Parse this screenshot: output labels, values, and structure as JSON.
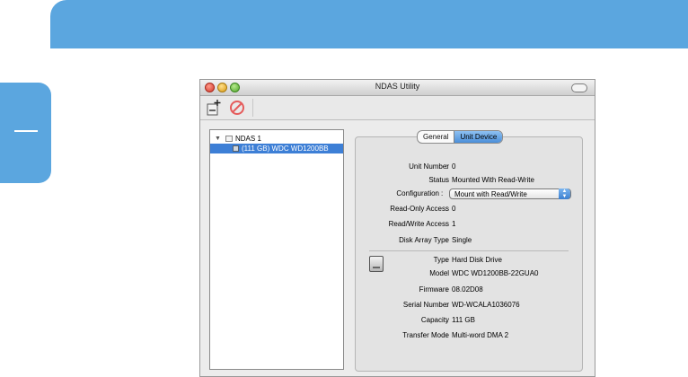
{
  "window": {
    "title": "NDAS Utility"
  },
  "toolbar": {
    "add_icon": "add-device-icon",
    "remove_icon": "remove-device-icon"
  },
  "tree": {
    "parent": {
      "label": "NDAS 1"
    },
    "child": {
      "label": "(111 GB) WDC WD1200BB"
    }
  },
  "tabs": {
    "general": "General",
    "unit_device": "Unit Device"
  },
  "details": {
    "unit_number": {
      "label": "Unit Number",
      "value": "0"
    },
    "status": {
      "label": "Status",
      "value": "Mounted With Read-Write"
    },
    "configuration": {
      "label": "Configuration",
      "value": "Mount with Read/Write"
    },
    "ro_access": {
      "label": "Read-Only Access",
      "value": "0"
    },
    "rw_access": {
      "label": "Read/Write Access",
      "value": "1"
    },
    "array_type": {
      "label": "Disk Array Type",
      "value": "Single"
    },
    "type": {
      "label": "Type",
      "value": "Hard Disk Drive"
    },
    "model": {
      "label": "Model",
      "value": "WDC WD1200BB-22GUA0"
    },
    "firmware": {
      "label": "Firmware",
      "value": "08.02D08"
    },
    "serial": {
      "label": "Serial Number",
      "value": "WD-WCALA1036076"
    },
    "capacity": {
      "label": "Capacity",
      "value": "111 GB"
    },
    "transfer": {
      "label": "Transfer Mode",
      "value": "Multi-word DMA 2"
    }
  },
  "colors": {
    "banner": "#5ba6df",
    "selection": "#3d7fd6"
  }
}
